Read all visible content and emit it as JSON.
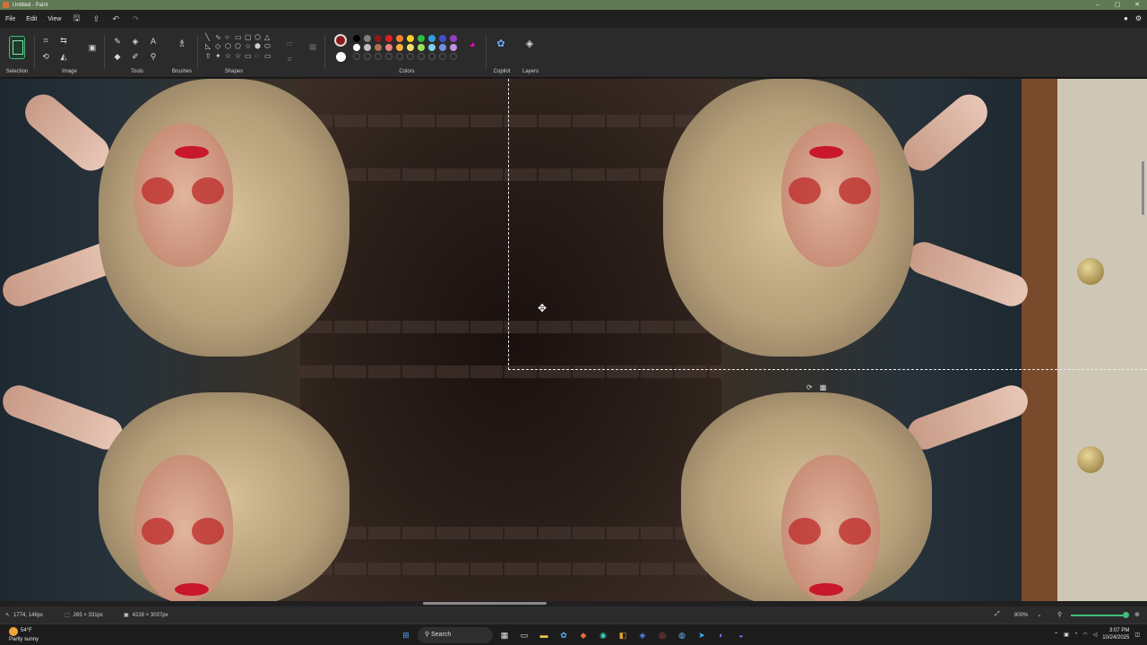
{
  "window": {
    "title": "Untitled - Paint",
    "controls": [
      "–",
      "▢",
      "✕"
    ]
  },
  "menu": {
    "items": [
      "File",
      "Edit",
      "View"
    ],
    "quick_icons": [
      "save-icon",
      "share-icon",
      "undo-icon",
      "redo-icon"
    ],
    "right_icons": [
      "account-icon",
      "settings-icon"
    ]
  },
  "ribbon": {
    "groups": {
      "selection": "Selection",
      "image": "Image",
      "tools": "Tools",
      "brushes": "Brushes",
      "shapes": "Shapes",
      "colors": "Colors",
      "copilot": "Copilot",
      "layers": "Layers"
    },
    "shape_glyphs": [
      "╲",
      "∿",
      "○",
      "▭",
      "▢",
      "⬠",
      "△",
      "◺",
      "◇",
      "⬡",
      "⬠",
      "☆",
      "⬢",
      "⬭",
      "⇧",
      "✦",
      "☆",
      "☆",
      "▭",
      "◌",
      "▭"
    ],
    "colors": {
      "primary": "#8b1a1a",
      "secondary": "#ffffff",
      "palette_row1": [
        "#000000",
        "#808080",
        "#8b1a1a",
        "#e02020",
        "#f08030",
        "#f8d020",
        "#30c040",
        "#30a0e0",
        "#4050d0",
        "#9040c0"
      ],
      "palette_row2": [
        "#ffffff",
        "#c0c0c0",
        "#b07050",
        "#f08080",
        "#f8b040",
        "#f0e070",
        "#a0e060",
        "#80d0f0",
        "#7090e0",
        "#c090e0"
      ],
      "palette_row3_empty": 10
    }
  },
  "status": {
    "cursor": "1774, 146px",
    "selection": "265 × 331px",
    "image_size": "4228 × 3037px",
    "zoom": "800%"
  },
  "taskbar": {
    "weather_temp": "54°F",
    "weather_desc": "Partly sunny",
    "search": "Search",
    "time": "3:07 PM",
    "date": "10/24/2025"
  }
}
